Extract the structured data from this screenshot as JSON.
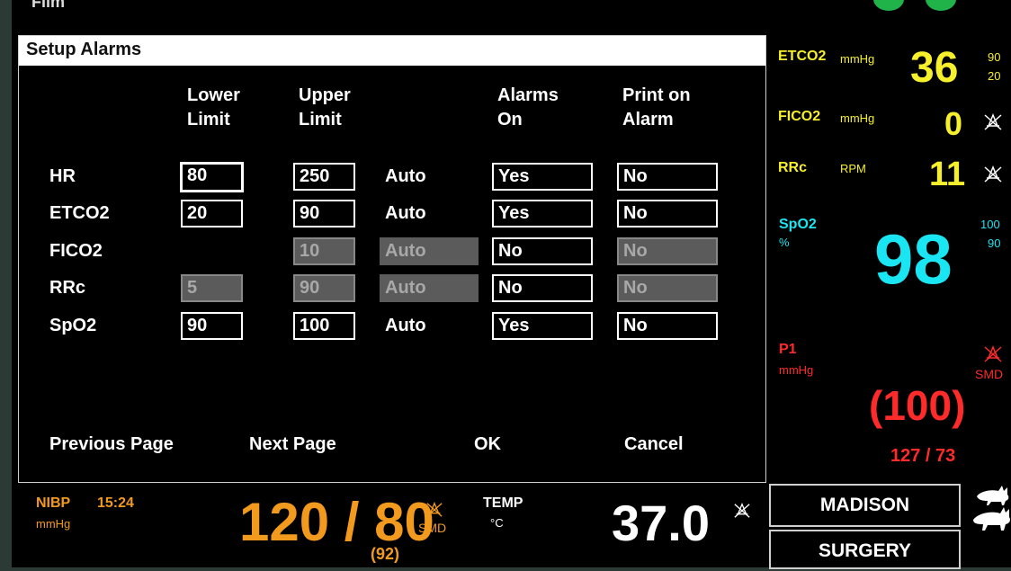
{
  "top_label": "Film",
  "dialog": {
    "title": "Setup Alarms",
    "headers": {
      "lower": "Lower\nLimit",
      "upper": "Upper\nLimit",
      "alarms_on": "Alarms\nOn",
      "print": "Print on\nAlarm"
    },
    "rows": [
      {
        "label": "HR",
        "lower": "80",
        "upper": "250",
        "auto": "Auto",
        "alarms": "Yes",
        "print": "No"
      },
      {
        "label": "ETCO2",
        "lower": "20",
        "upper": "90",
        "auto": "Auto",
        "alarms": "Yes",
        "print": "No"
      },
      {
        "label": "FICO2",
        "lower": "",
        "upper": "10",
        "auto": "Auto",
        "alarms": "No",
        "print": "No"
      },
      {
        "label": "RRc",
        "lower": "5",
        "upper": "90",
        "auto": "Auto",
        "alarms": "No",
        "print": "No"
      },
      {
        "label": "SpO2",
        "lower": "90",
        "upper": "100",
        "auto": "Auto",
        "alarms": "Yes",
        "print": "No"
      }
    ],
    "buttons": {
      "prev": "Previous Page",
      "next": "Next Page",
      "ok": "OK",
      "cancel": "Cancel"
    }
  },
  "vitals": {
    "etco2": {
      "label": "ETCO2",
      "unit": "mmHg",
      "value": "36",
      "high": "90",
      "low": "20"
    },
    "fico2": {
      "label": "FICO2",
      "unit": "mmHg",
      "value": "0"
    },
    "rrc": {
      "label": "RRc",
      "unit": "RPM",
      "value": "11"
    },
    "spo2": {
      "label": "SpO2",
      "unit": "%",
      "value": "98",
      "high": "100",
      "low": "90"
    },
    "p1": {
      "label": "P1",
      "unit": "mmHg",
      "mean": "(100)",
      "sys_dia": "127 / 73",
      "smd": "SMD"
    },
    "nibp": {
      "label": "NIBP",
      "time": "15:24",
      "unit": "mmHg",
      "value": "120 / 80",
      "mean": "(92)",
      "smd": "SMD"
    },
    "temp": {
      "label": "TEMP",
      "unit": "°C",
      "value": "37.0"
    }
  },
  "patient": {
    "name": "MADISON",
    "location": "SURGERY"
  },
  "colors": {
    "yellow": "#f6ef2c",
    "cyan": "#19e6f2",
    "red": "#ff2a2a",
    "orange": "#f29a1d"
  }
}
